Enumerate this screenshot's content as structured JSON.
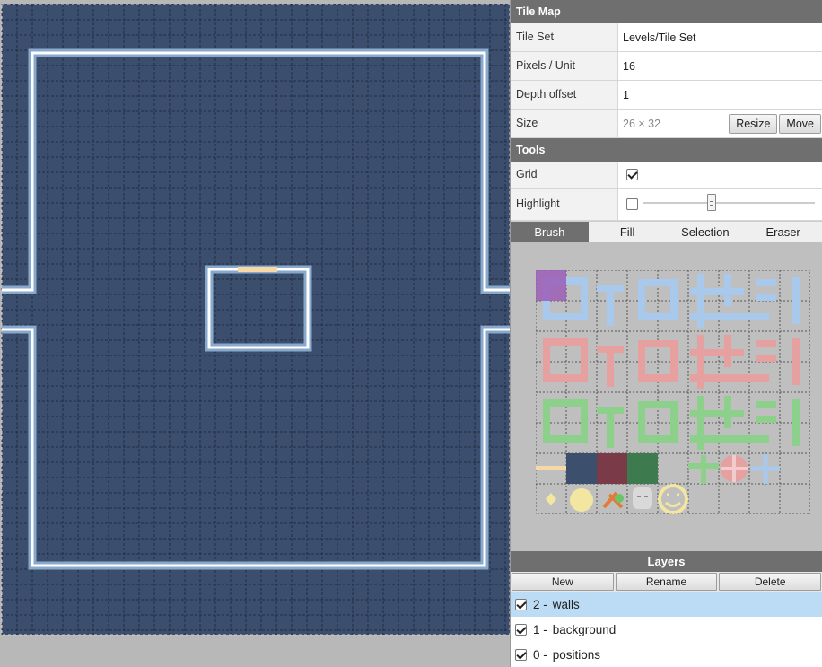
{
  "tilemap": {
    "header": "Tile Map",
    "tile_set_label": "Tile Set",
    "tile_set_value": "Levels/Tile Set",
    "pixels_label": "Pixels / Unit",
    "pixels_value": "16",
    "depth_label": "Depth offset",
    "depth_value": "1",
    "size_label": "Size",
    "size_value": "26 × 32",
    "resize_label": "Resize",
    "move_label": "Move"
  },
  "tools": {
    "header": "Tools",
    "grid_label": "Grid",
    "grid_checked": true,
    "highlight_label": "Highlight",
    "highlight_checked": false,
    "highlight_level": 0.4
  },
  "tabs": [
    "Brush",
    "Fill",
    "Selection",
    "Eraser"
  ],
  "active_tab": "Brush",
  "colors": {
    "map_floor": "#3b4e6e",
    "wall_blue": "#a9c9ec",
    "wall_red": "#e6a0a0",
    "wall_green": "#8cd08c",
    "selected_tile": "#9b59b6",
    "door": "#f7d9a8",
    "tile_dark_blue": "#3c4f6d",
    "tile_dark_red": "#7a3a48",
    "tile_dark_green": "#3d7a4e",
    "yellow": "#f2e6a0",
    "panel_header": "#6f6f6f",
    "selected_layer": "#bcdcf5"
  },
  "layers": {
    "header": "Layers",
    "new_label": "New",
    "rename_label": "Rename",
    "delete_label": "Delete",
    "items": [
      {
        "num": "2 -",
        "name": "walls",
        "checked": true,
        "selected": true
      },
      {
        "num": "1 -",
        "name": "background",
        "checked": true,
        "selected": false
      },
      {
        "num": "0 -",
        "name": "positions",
        "checked": true,
        "selected": false
      }
    ]
  }
}
